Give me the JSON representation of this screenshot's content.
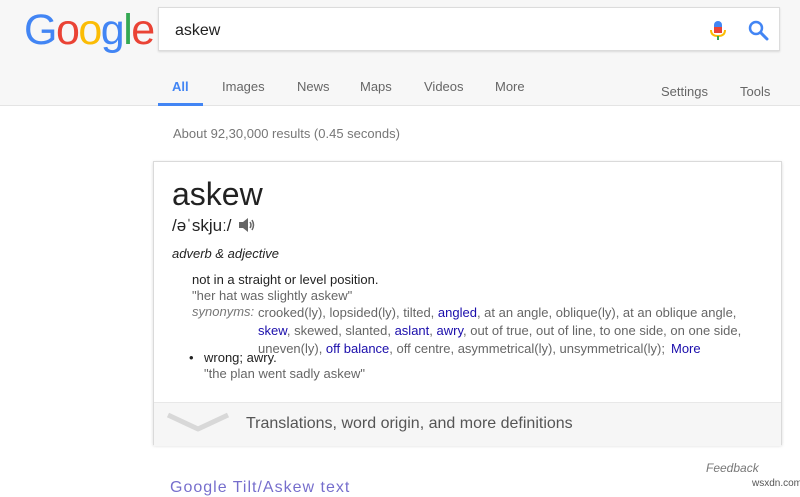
{
  "logo": {
    "letters": [
      {
        "ch": "G",
        "color": "#4285f4"
      },
      {
        "ch": "o",
        "color": "#ea4335"
      },
      {
        "ch": "o",
        "color": "#fbbc05"
      },
      {
        "ch": "g",
        "color": "#4285f4"
      },
      {
        "ch": "l",
        "color": "#34a853"
      },
      {
        "ch": "e",
        "color": "#ea4335"
      }
    ]
  },
  "search": {
    "query": "askew",
    "mic_icon": "microphone-icon",
    "search_icon": "search-icon"
  },
  "tabs": {
    "all": "All",
    "images": "Images",
    "news": "News",
    "maps": "Maps",
    "videos": "Videos",
    "more": "More",
    "settings": "Settings",
    "tools": "Tools"
  },
  "results_stats": "About 92,30,000 results (0.45 seconds)",
  "dictionary": {
    "word": "askew",
    "phonetic": "/əˈskjuː/",
    "speaker_icon": "speaker-icon",
    "part_of_speech": "adverb & adjective",
    "definitions": [
      {
        "text": "not in a straight or level position.",
        "example": "\"her hat was slightly askew\"",
        "synonyms_label": "synonyms:",
        "synonym_lines": [
          [
            {
              "t": "crooked(ly), lopsided(ly), tilted, ",
              "link": false
            },
            {
              "t": "angled",
              "link": true
            },
            {
              "t": ", at an angle, oblique(ly), at an oblique angle,",
              "link": false
            }
          ],
          [
            {
              "t": "skew",
              "link": true
            },
            {
              "t": ", skewed, slanted, ",
              "link": false
            },
            {
              "t": "aslant",
              "link": true
            },
            {
              "t": ", ",
              "link": false
            },
            {
              "t": "awry",
              "link": true
            },
            {
              "t": ", out of true, out of line, to one side, on one side,",
              "link": false
            }
          ],
          [
            {
              "t": "uneven(ly), ",
              "link": false
            },
            {
              "t": "off balance",
              "link": true
            },
            {
              "t": ", off centre, asymmetrical(ly), unsymmetrical(ly);",
              "link": false
            }
          ]
        ],
        "more_label": "More"
      },
      {
        "bullet": "•",
        "text": "wrong; awry.",
        "example": "\"the plan went sadly askew\""
      }
    ],
    "footer_label": "Translations, word origin, and more definitions",
    "expand_icon": "chevron-down-icon"
  },
  "feedback_label": "Feedback",
  "partial_result_text": "Google Tilt/Askew text",
  "watermark": "wsxdn.com",
  "colors": {
    "accent": "#4285f4",
    "link": "#1a0dab"
  }
}
